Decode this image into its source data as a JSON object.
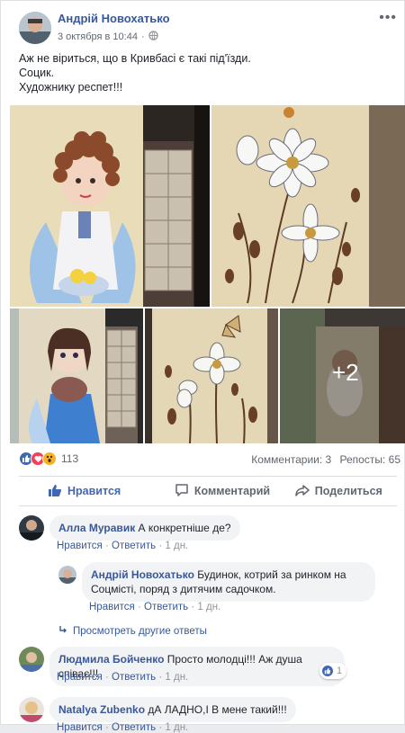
{
  "post": {
    "author": "Андрій Новохатько",
    "timestamp": "3 октября в 10:44",
    "privacy_icon": "globe-icon",
    "more_icon": "ellipsis-icon",
    "lines": [
      "Аж не віриться, що в Кривбасі є такі під'їзди.",
      "Социк.",
      "Художнику респет!!!"
    ],
    "photos_more": "+2"
  },
  "reactions": {
    "icons": [
      "like-icon",
      "love-icon",
      "wow-icon"
    ],
    "count": "113",
    "comments": "Комментарии: 3",
    "shares": "Репосты: 65"
  },
  "actions": {
    "like": "Нравится",
    "comment": "Комментарий",
    "share": "Поделиться"
  },
  "colors": {
    "link": "#385898",
    "like_blue": "#4267b2",
    "love_red": "#f33e58",
    "wow_yellow": "#f7b125"
  },
  "comments": [
    {
      "name": "Алла Муравик",
      "text": "А конкретніше де?",
      "like": "Нравится",
      "reply": "Ответить",
      "age": "1 дн."
    },
    {
      "name": "Андрій Новохатько",
      "text": "Будинок, котрий за ринком на Соцмісті, поряд з дитячим садочком.",
      "like": "Нравится",
      "reply": "Ответить",
      "age": "1 дн."
    },
    {
      "name": "Людмила Бойченко",
      "text": "Просто молодці!!! Аж душа співає!!!",
      "like": "Нравится",
      "reply": "Ответить",
      "age": "1 дн.",
      "reaction_count": "1"
    },
    {
      "name": "Natalya Zubenko",
      "text": "дА ЛАДНО,І В мене такий!!!",
      "like": "Нравится",
      "reply": "Ответить",
      "age": "1 дн."
    }
  ],
  "more_replies": "Просмотреть другие ответы",
  "separator": "·"
}
